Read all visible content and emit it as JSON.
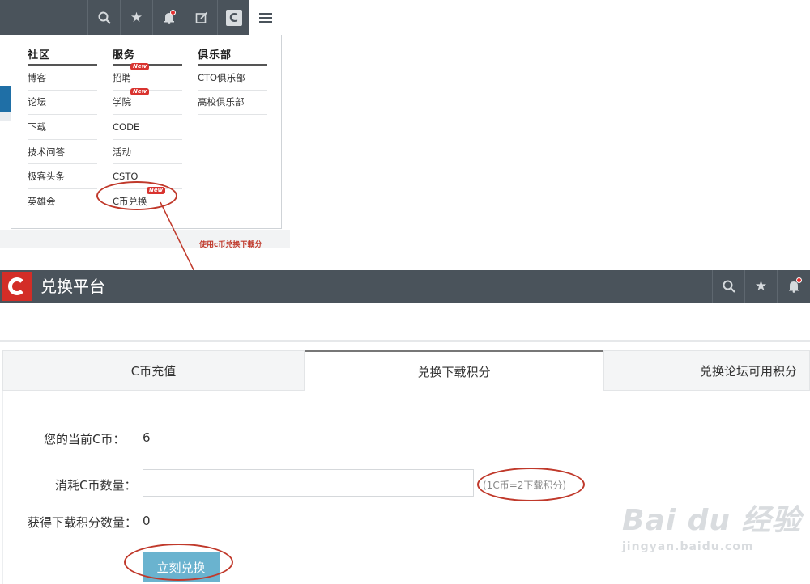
{
  "menu": {
    "columns": [
      {
        "title": "社区",
        "items": [
          {
            "label": "博客"
          },
          {
            "label": "论坛"
          },
          {
            "label": "下载"
          },
          {
            "label": "技术问答"
          },
          {
            "label": "极客头条"
          },
          {
            "label": "英雄会"
          }
        ]
      },
      {
        "title": "服务",
        "items": [
          {
            "label": "招聘",
            "badge": "New"
          },
          {
            "label": "学院",
            "badge": "New"
          },
          {
            "label": "CODE"
          },
          {
            "label": "活动"
          },
          {
            "label": "CSTO"
          },
          {
            "label": "C币兑换",
            "badge": "New"
          }
        ]
      },
      {
        "title": "俱乐部",
        "items": [
          {
            "label": "CTO俱乐部"
          },
          {
            "label": "高校俱乐部"
          }
        ]
      }
    ],
    "toolbar_icons": [
      "search-icon",
      "star-icon",
      "bell-icon",
      "edit-icon",
      "c-logo-icon",
      "menu-icon"
    ],
    "hint": "使用c币兑换下载分"
  },
  "platform": {
    "title": "兑换平台",
    "header_icons": [
      "search-icon",
      "star-icon",
      "bell-icon"
    ],
    "tabs": [
      {
        "label": "C币充值"
      },
      {
        "label": "兑换下载积分"
      },
      {
        "label": "兑换论坛可用积分"
      }
    ],
    "active_tab": 1,
    "current_coins_label": "您的当前C币：",
    "current_coins_value": "6",
    "spend_label": "消耗C币数量：",
    "spend_value": "",
    "rate_text": "(1C币=2下载积分)",
    "gain_label": "获得下载积分数量：",
    "gain_value": "0",
    "submit_label": "立刻兑换"
  },
  "watermark": {
    "line1": "Bai du 经验",
    "line2": "jingyan.baidu.com"
  },
  "colors": {
    "topbar": "#4a535b",
    "brand_red": "#d32d27",
    "annotation_red": "#c0392b",
    "button_blue": "#6ab3cf",
    "new_badge": "#d9332f"
  }
}
